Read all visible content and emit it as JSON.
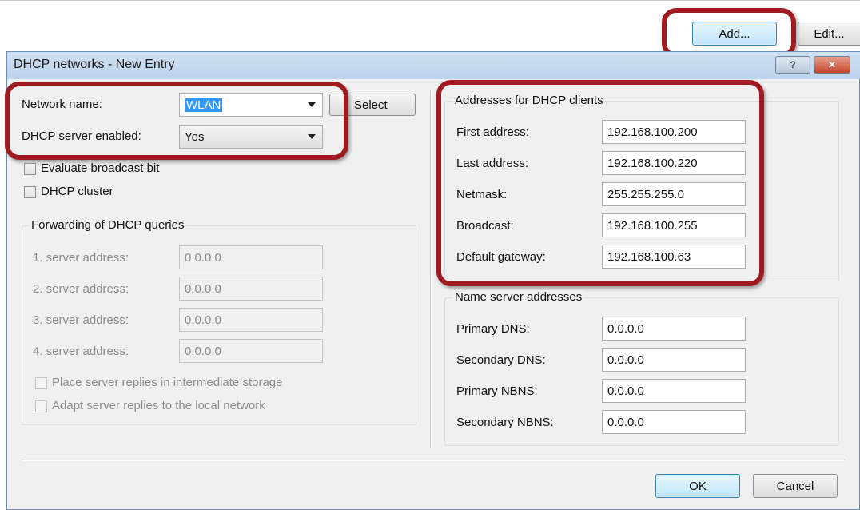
{
  "toolbar": {
    "add_label": "Add...",
    "edit_label": "Edit..."
  },
  "dialog": {
    "title": "DHCP networks - New Entry",
    "help_glyph": "?",
    "close_glyph": "✕"
  },
  "left": {
    "network_name_label": "Network name:",
    "network_name_value": "WLAN",
    "select_button": "Select",
    "dhcp_enabled_label": "DHCP server enabled:",
    "dhcp_enabled_value": "Yes",
    "evaluate_broadcast_label": "Evaluate broadcast bit",
    "dhcp_cluster_label": "DHCP cluster",
    "forwarding": {
      "title": "Forwarding of DHCP queries",
      "servers": [
        {
          "label": "1. server address:",
          "value": "0.0.0.0"
        },
        {
          "label": "2. server address:",
          "value": "0.0.0.0"
        },
        {
          "label": "3. server address:",
          "value": "0.0.0.0"
        },
        {
          "label": "4. server address:",
          "value": "0.0.0.0"
        }
      ],
      "place_replies_label": "Place server replies in intermediate storage",
      "adapt_replies_label": "Adapt server replies to the local network"
    }
  },
  "right": {
    "addresses": {
      "title": "Addresses for DHCP clients",
      "first_label": "First address:",
      "first_value": "192.168.100.200",
      "last_label": "Last address:",
      "last_value": "192.168.100.220",
      "netmask_label": "Netmask:",
      "netmask_value": "255.255.255.0",
      "broadcast_label": "Broadcast:",
      "broadcast_value": "192.168.100.255",
      "gateway_label": "Default gateway:",
      "gateway_value": "192.168.100.63"
    },
    "nameservers": {
      "title": "Name server addresses",
      "primary_dns_label": "Primary DNS:",
      "primary_dns_value": "0.0.0.0",
      "secondary_dns_label": "Secondary DNS:",
      "secondary_dns_value": "0.0.0.0",
      "primary_nbns_label": "Primary NBNS:",
      "primary_nbns_value": "0.0.0.0",
      "secondary_nbns_label": "Secondary NBNS:",
      "secondary_nbns_value": "0.0.0.0"
    }
  },
  "footer": {
    "ok_label": "OK",
    "cancel_label": "Cancel"
  },
  "colors": {
    "highlight": "#9e1b22",
    "focus_button": "#bee6fd",
    "dialog_bg": "#f0f0f0",
    "selection": "#3399ff"
  }
}
